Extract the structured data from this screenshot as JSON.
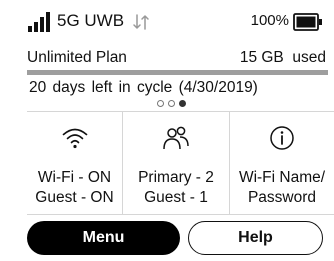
{
  "status_bar": {
    "network": "5G UWB",
    "signal_bars": 4,
    "signal_icon": "signal-bars-icon",
    "transfer_icon": "data-transfer-arrows-icon",
    "battery_percent": "100%",
    "battery_level": 1.0,
    "battery_icon": "battery-full-icon"
  },
  "plan": {
    "name": "Unlimited Plan",
    "usage": "15 GB  used",
    "usage_fraction": 1.0,
    "cycle": "20 days left in cycle (4/30/2019)"
  },
  "pager": {
    "count": 3,
    "active_index": 2
  },
  "tiles": [
    {
      "icon": "wifi-icon",
      "line1": "Wi-Fi - ON",
      "line2": "Guest - ON"
    },
    {
      "icon": "users-icon",
      "line1": "Primary - 2",
      "line2": "Guest - 1"
    },
    {
      "icon": "info-icon",
      "line1": "Wi-Fi Name/",
      "line2": "Password"
    }
  ],
  "buttons": {
    "menu": "Menu",
    "help": "Help"
  },
  "colors": {
    "primary_button": "#000000",
    "usage_bar": "#9e9e9e",
    "divider": "#d6d6d6"
  }
}
